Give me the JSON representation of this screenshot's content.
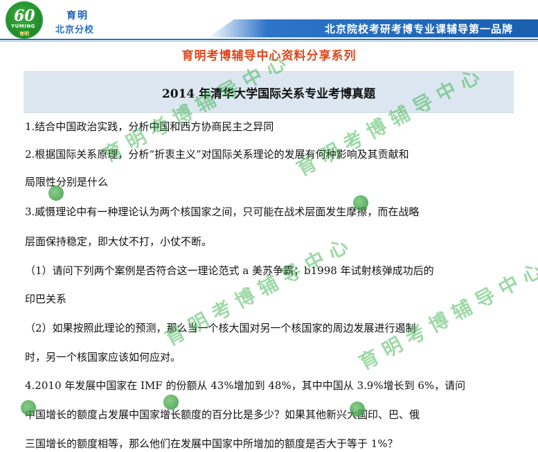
{
  "header": {
    "logo_number": "60",
    "logo_english": "YUMING",
    "logo_chinese": "育明",
    "brand_name": "育明",
    "branch": "北京分校",
    "slogan": "北京院校考研考博专业课辅导第一品牌"
  },
  "series_title": "育明考博辅导中心资料分享系列",
  "doc_title": "2014 年清华大学国际关系专业考博真题",
  "questions": [
    "1.结合中国政治实践，分析中国和西方协商民主之异同",
    "2.根据国际关系原理，分析“折衷主义”对国际关系理论的发展有何种影响及其贡献和",
    "局限性分别是什么",
    "3.威慑理论中有一种理论认为两个核国家之间，只可能在战术层面发生摩擦，而在战略",
    "层面保持稳定，即大仗不打，小仗不断。",
    "（1）请问下列两个案例是否符合这一理论范式 a 美苏争霸；b1998 年试射核弹成功后的",
    "印巴关系",
    "（2）如果按照此理论的预测，那么当一个核大国对另一个核国家的周边发展进行遏制",
    "时，另一个核国家应该如何应对。",
    "4.2010 年发展中国家在 IMF 的份额从 43%增加到 48%，其中中国从 3.9%增长到 6%，请问",
    "中国增长的额度占发展中国家增长额度的百分比是多少？如果其他新兴大国印、巴、俄",
    "三国增长的额度相等，那么他们在发展中国家中所增加的额度是否大于等于 1%？"
  ],
  "watermark": {
    "text": "育明考博辅导中心",
    "badge_text": "育明教育"
  },
  "colors": {
    "brand_blue": "#1a5fb0",
    "series_red": "#e0451a",
    "title_bg": "#dde7f1",
    "watermark_green": "#28aa3c"
  }
}
